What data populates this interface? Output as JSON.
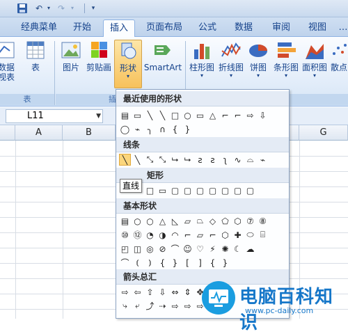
{
  "quick_access": {
    "save_icon": "save-icon",
    "undo_icon": "undo-icon",
    "redo_icon": "redo-icon",
    "customize_icon": "customize-icon"
  },
  "tabs": [
    {
      "label": "经典菜单",
      "active": false
    },
    {
      "label": "开始",
      "active": false
    },
    {
      "label": "插入",
      "active": true
    },
    {
      "label": "页面布局",
      "active": false
    },
    {
      "label": "公式",
      "active": false
    },
    {
      "label": "数据",
      "active": false
    },
    {
      "label": "审阅",
      "active": false
    },
    {
      "label": "视图",
      "active": false
    }
  ],
  "ribbon": {
    "pivot_label": "数据\n视表",
    "table_label": "表",
    "picture_label": "图片",
    "clipart_label": "剪贴画",
    "shapes_label": "形状",
    "smartart_label": "SmartArt",
    "column_chart_label": "柱形图",
    "line_chart_label": "折线图",
    "pie_chart_label": "饼图",
    "bar_chart_label": "条形图",
    "area_chart_label": "面积图",
    "scatter_chart_label": "散点",
    "group_tables_label": "表",
    "group_illus_label": "插"
  },
  "formula_bar": {
    "name_box_value": "L11"
  },
  "grid": {
    "columns": [
      "A",
      "B",
      "G"
    ]
  },
  "dropdown": {
    "recent_title": "最近使用的形状",
    "lines_title": "线条",
    "rect_title": "矩形",
    "basic_title": "基本形状",
    "arrows_title": "箭头总汇",
    "recent_row1": [
      "▤",
      "▭",
      "╲",
      "╲",
      "□",
      "○",
      "▭",
      "△",
      "⌐",
      "⌐",
      "⇨",
      "⇩"
    ],
    "recent_row2": [
      "◯",
      "⌁",
      "╮",
      "∩",
      "{",
      "}"
    ],
    "lines_row": [
      "╲",
      "╲",
      "⤡",
      "⤡",
      "⮡",
      "⮡",
      "ƨ",
      "ƨ",
      "ʅ",
      "∿",
      "⌓",
      "⌁"
    ],
    "rect_row": [
      "□",
      "▭",
      "▢",
      "▢",
      "▢",
      "▢",
      "▢",
      "▢",
      "▢"
    ],
    "basic_row1": [
      "▤",
      "○",
      "○",
      "△",
      "◺",
      "▱",
      "⏢",
      "◇",
      "⬠",
      "⬡",
      "⑦",
      "⑧"
    ],
    "basic_row2": [
      "⑩",
      "⑫",
      "◔",
      "◑",
      "◠",
      "⌐",
      "▱",
      "⌐",
      "⬡",
      "✚",
      "⬭",
      "⌸"
    ],
    "basic_row3": [
      "◰",
      "◫",
      "◎",
      "⊘",
      "⌒",
      "☺",
      "♡",
      "⚡",
      "✺",
      "☾",
      "☁"
    ],
    "basic_row4": [
      "⌒",
      "⦅",
      "⦆",
      "{",
      "}",
      "[",
      "]",
      "{",
      "}"
    ],
    "arrows_row1": [
      "⇨",
      "⇦",
      "⇧",
      "⇩",
      "⇔",
      "⇕",
      "✥"
    ],
    "arrows_row2": [
      "⤷",
      "⤶",
      "⤴",
      "⇢",
      "⇨",
      "⇨",
      "⇨"
    ],
    "tooltip": "直线"
  },
  "watermark": {
    "text": "电脑百科知识",
    "url": "www.pc-daily.com"
  }
}
